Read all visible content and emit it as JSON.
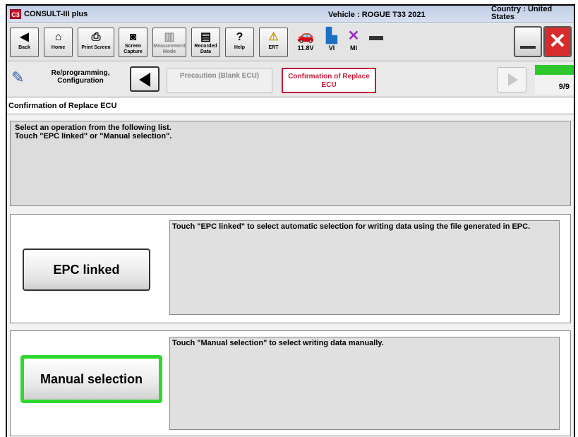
{
  "app": {
    "logo": "C3",
    "name": "CONSULT-III plus"
  },
  "header": {
    "vehicle": "Vehicle : ROGUE T33 2021",
    "country": "Country : United States"
  },
  "toolbar": {
    "back": "Back",
    "home": "Home",
    "print_screen": "Print Screen",
    "screen_capture": "Screen Capture",
    "measurement_mode": "Measurement Mode",
    "recorded_data": "Recorded Data",
    "help": "Help",
    "ert": "ERT",
    "voltage": "11.8V",
    "vi": "VI",
    "mi": "MI"
  },
  "nav": {
    "section": "Re/programming, Configuration",
    "prev_step": "Precaution (Blank ECU)",
    "current_step": "Confirmation of Replace ECU",
    "progress_label": "9/9",
    "progress_fraction": 1.0
  },
  "screen": {
    "title": "Confirmation of Replace ECU",
    "instruction_line1": "Select an operation from the following list.",
    "instruction_line2": "Touch \"EPC linked\" or \"Manual selection\"."
  },
  "options": {
    "epc": {
      "label": "EPC linked",
      "description": "Touch \"EPC linked\" to select automatic selection for writing data using the file generated in EPC."
    },
    "manual": {
      "label": "Manual selection",
      "description": "Touch \"Manual selection\" to select writing data manually."
    }
  },
  "colors": {
    "highlight": "#2fd82f",
    "current_step": "#c41a3a",
    "progress": "#2ec82e"
  }
}
